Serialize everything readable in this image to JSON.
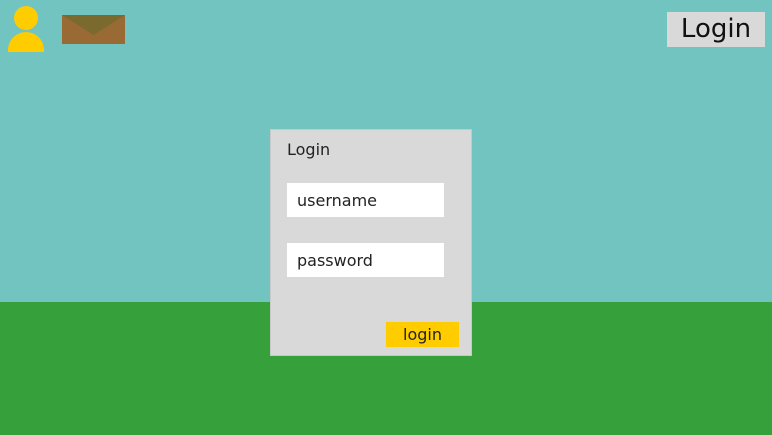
{
  "colors": {
    "sky": "#72c4c1",
    "ground": "#36a13a",
    "panel": "#d9d9d9",
    "accent": "#ffcc00",
    "avatar": "#ffcc00",
    "mail_body": "#9a6a34",
    "mail_flap": "#7a6a2e",
    "top_button": "#d9d9d9"
  },
  "header": {
    "avatar_icon": "person-icon",
    "mail_icon": "envelope-icon",
    "login_button_label": "Login"
  },
  "login_panel": {
    "title": "Login",
    "username_placeholder": "username",
    "password_placeholder": "password",
    "submit_label": "login"
  }
}
